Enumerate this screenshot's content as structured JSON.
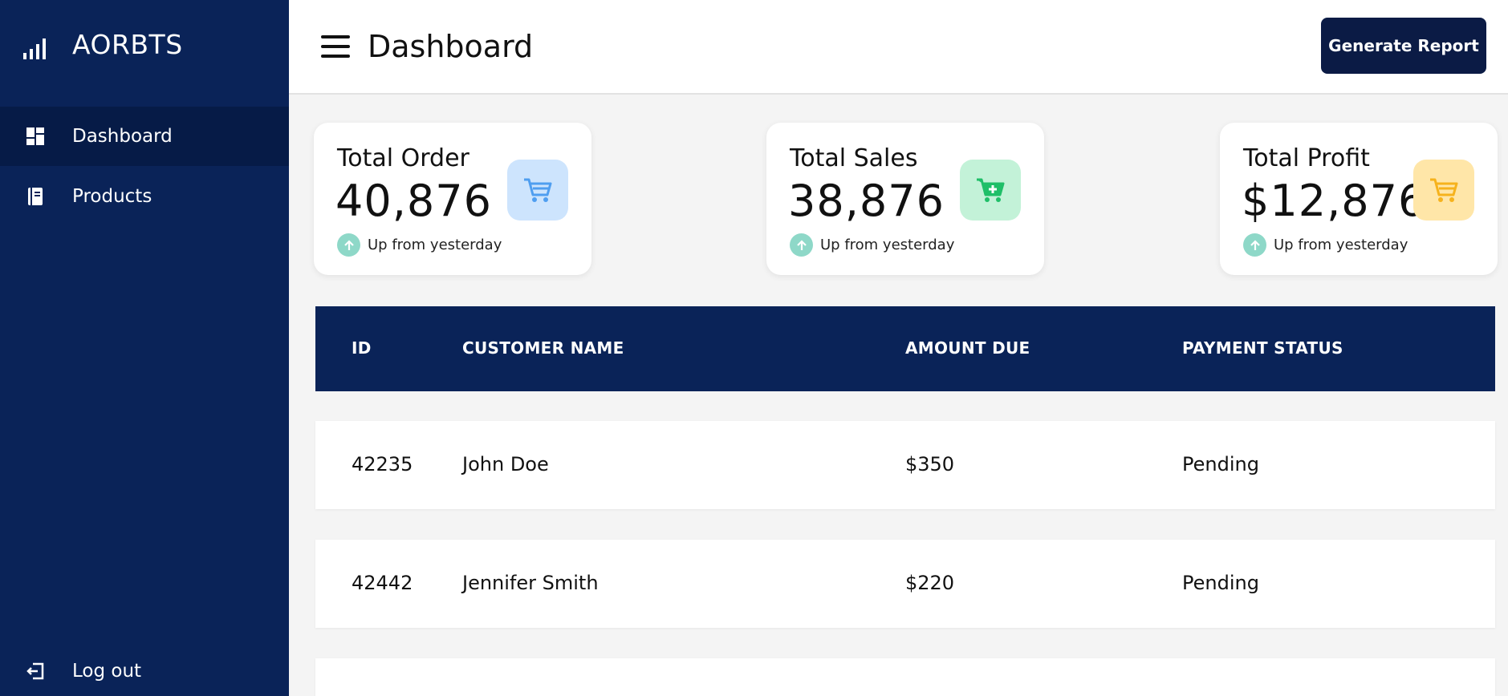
{
  "brand": {
    "name": "AORBTS",
    "icon": "signal-bars-icon"
  },
  "sidebar": {
    "items": [
      {
        "label": "Dashboard",
        "icon": "dashboard-grid-icon",
        "active": true
      },
      {
        "label": "Products",
        "icon": "notebook-icon",
        "active": false
      }
    ],
    "logout": {
      "label": "Log out",
      "icon": "logout-icon"
    }
  },
  "header": {
    "title": "Dashboard",
    "generate_label": "Generate Report"
  },
  "cards": [
    {
      "title": "Total Order",
      "value": "40,876",
      "trend": "Up from yesterday",
      "icon": "cart-icon",
      "icon_bg": "#cde4fd",
      "icon_color": "#4f9ef0"
    },
    {
      "title": "Total Sales",
      "value": "38,876",
      "trend": "Up from yesterday",
      "icon": "cart-plus-icon",
      "icon_bg": "#c3f2d8",
      "icon_color": "#1fbf68"
    },
    {
      "title": "Total Profit",
      "value": "$12,876",
      "trend": "Up from yesterday",
      "icon": "cart-icon",
      "icon_bg": "#ffe6a8",
      "icon_color": "#f6b21c"
    }
  ],
  "table": {
    "headers": [
      "ID",
      "CUSTOMER NAME",
      "AMOUNT DUE",
      "PAYMENT STATUS"
    ],
    "rows": [
      {
        "id": "42235",
        "name": "John Doe",
        "amount": "$350",
        "status": "Pending"
      },
      {
        "id": "42442",
        "name": "Jennifer Smith",
        "amount": "$220",
        "status": "Pending"
      }
    ]
  },
  "colors": {
    "sidebar_bg": "#0a2358",
    "button_bg": "#0b1b45",
    "trend_green": "#8ed8c8"
  }
}
